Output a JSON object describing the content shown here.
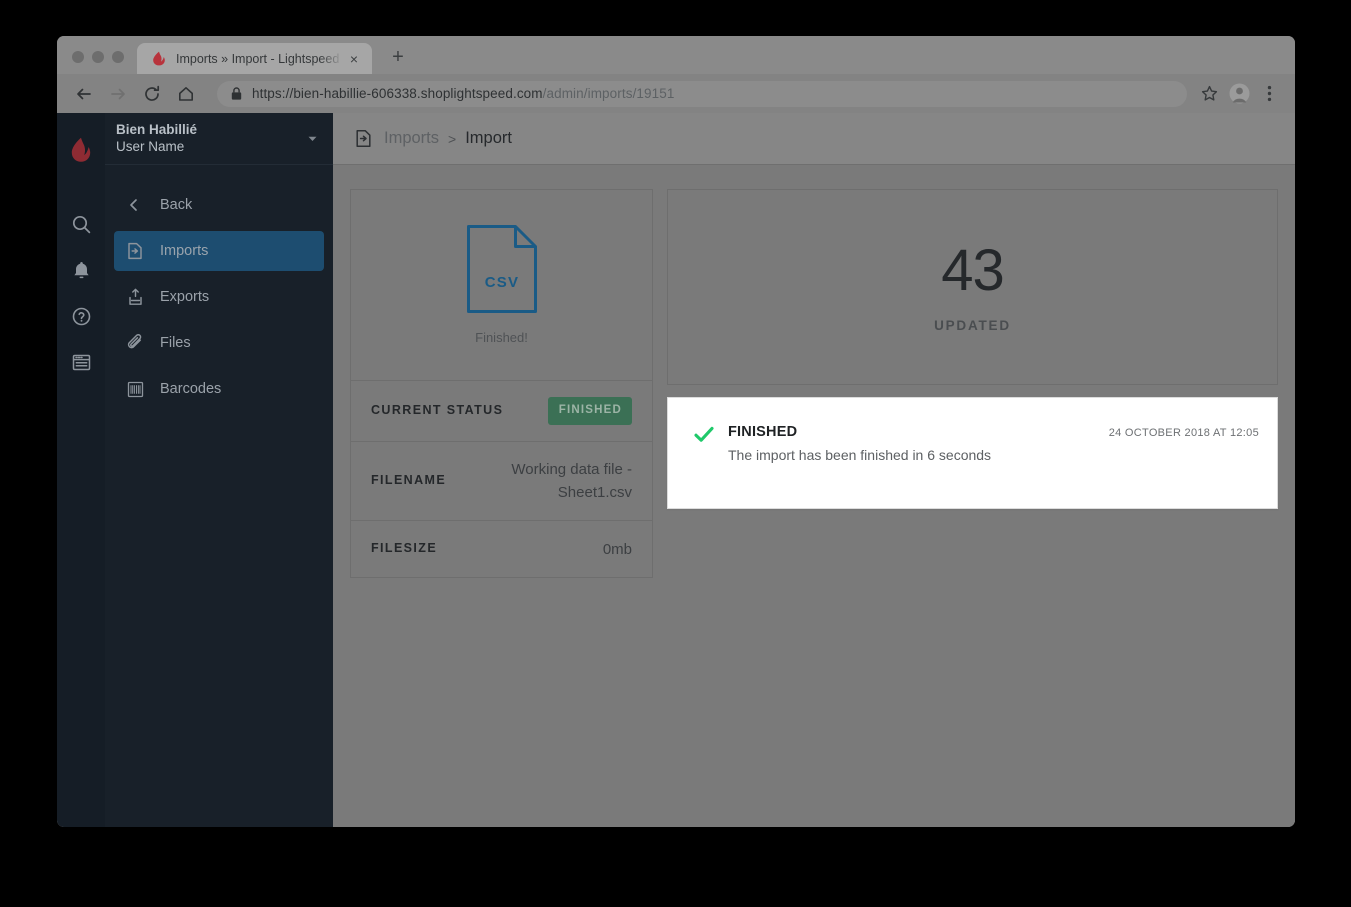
{
  "browser": {
    "tab": {
      "title": "Imports » Import - Lightspeed",
      "favicon": "lightspeed-flame-icon",
      "close": "×"
    },
    "new_tab_label": "+",
    "nav": {
      "back": "←",
      "forward": "→",
      "reload": "⟳",
      "home": "⌂"
    },
    "omnibox": {
      "url_scheme_host": "https://bien-habillie-606338.shoplightspeed.com",
      "url_path": "/admin/imports/19151",
      "lock": "lock-icon"
    },
    "actions": {
      "bookmark": "star-icon",
      "profile": "profile-avatar-icon",
      "menu": "three-dot-menu-icon"
    }
  },
  "rail": {
    "logo": "lightspeed-flame-logo",
    "icons": [
      {
        "name": "search-icon"
      },
      {
        "name": "notifications-bell-icon"
      },
      {
        "name": "help-circle-icon"
      },
      {
        "name": "storefront-window-icon"
      }
    ]
  },
  "sidebar": {
    "account": {
      "shop": "Bien Habillié",
      "user": "User Name",
      "caret": "▼"
    },
    "items": [
      {
        "label": "Back",
        "icon": "chevron-left-icon",
        "active": false,
        "name": "sidebar-item-back"
      },
      {
        "label": "Imports",
        "icon": "import-file-icon",
        "active": true,
        "name": "sidebar-item-imports"
      },
      {
        "label": "Exports",
        "icon": "export-upload-icon",
        "active": false,
        "name": "sidebar-item-exports"
      },
      {
        "label": "Files",
        "icon": "paperclip-icon",
        "active": false,
        "name": "sidebar-item-files"
      },
      {
        "label": "Barcodes",
        "icon": "barcode-icon",
        "active": false,
        "name": "sidebar-item-barcodes"
      }
    ]
  },
  "breadcrumb": {
    "icon": "import-file-icon",
    "parent": "Imports",
    "separator": ">",
    "current": "Import"
  },
  "file_card": {
    "file_type": "CSV",
    "status_text": "Finished!"
  },
  "details": [
    {
      "label": "CURRENT STATUS",
      "value": "FINISHED",
      "type": "badge",
      "badge_color": "#3b7055"
    },
    {
      "label": "FILENAME",
      "value": "Working data file - Sheet1.csv",
      "type": "text"
    },
    {
      "label": "FILESIZE",
      "value": "0mb",
      "type": "text"
    }
  ],
  "stat": {
    "number": "43",
    "label": "UPDATED"
  },
  "log": [
    {
      "icon": "check-mark-icon",
      "icon_color": "#1fc96a",
      "title": "FINISHED",
      "time": "24 OCTOBER 2018 AT 12:05",
      "description": "The import has been finished in 6 seconds"
    }
  ]
}
